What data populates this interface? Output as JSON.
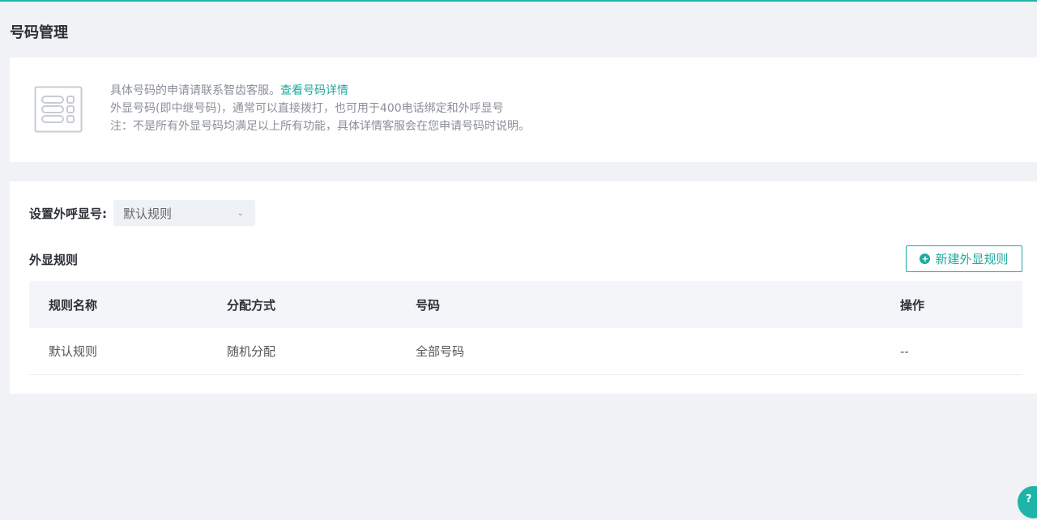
{
  "page": {
    "title": "号码管理"
  },
  "info": {
    "line1_text": "具体号码的申请请联系智齿客服。",
    "line1_link": "查看号码详情",
    "line2": "外显号码(即中继号码)，通常可以直接拨打，也可用于400电话绑定和外呼显号",
    "line3": "注：不是所有外显号码均满足以上所有功能，具体详情客服会在您申请号码时说明。",
    "icon": "number-card-icon"
  },
  "setting": {
    "label": "设置外呼显号:",
    "selected": "默认规则"
  },
  "rules": {
    "title": "外显规则",
    "new_button": "新建外显规则",
    "columns": [
      "规则名称",
      "分配方式",
      "号码",
      "操作"
    ],
    "rows": [
      [
        "默认规则",
        "随机分配",
        "全部号码",
        "--"
      ]
    ]
  },
  "colors": {
    "accent": "#1fa99f"
  }
}
